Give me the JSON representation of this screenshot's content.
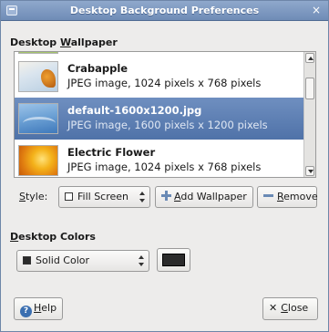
{
  "window": {
    "title": "Desktop Background Preferences",
    "close_glyph": "×"
  },
  "wallpaper_section": {
    "label_pre": "Desktop ",
    "label_accel": "W",
    "label_post": "allpaper"
  },
  "wallpapers": [
    {
      "name": "Crabapple",
      "description": "JPEG image, 1024 pixels x 768 pixels",
      "icon": "crabapple-thumbnail",
      "selected": false
    },
    {
      "name": "default-1600x1200.jpg",
      "description": "JPEG image, 1600 pixels x 1200 pixels",
      "icon": "default-wallpaper-thumbnail",
      "selected": true
    },
    {
      "name": "Electric Flower",
      "description": "JPEG image, 1024 pixels x 768 pixels",
      "icon": "electric-flower-thumbnail",
      "selected": false
    }
  ],
  "style": {
    "label_accel": "S",
    "label_post": "tyle:",
    "selected_value": "Fill Screen"
  },
  "buttons": {
    "add_pre": "",
    "add_accel": "A",
    "add_post": "dd Wallpaper",
    "remove_pre": "",
    "remove_accel": "R",
    "remove_post": "emove"
  },
  "colors_section": {
    "label_accel": "D",
    "label_post": "esktop Colors",
    "selected_value": "Solid Color",
    "swatch_color": "#2b2b2b"
  },
  "footer": {
    "help_accel": "H",
    "help_post": "elp",
    "close_pre": "",
    "close_accel": "C",
    "close_post": "lose"
  }
}
